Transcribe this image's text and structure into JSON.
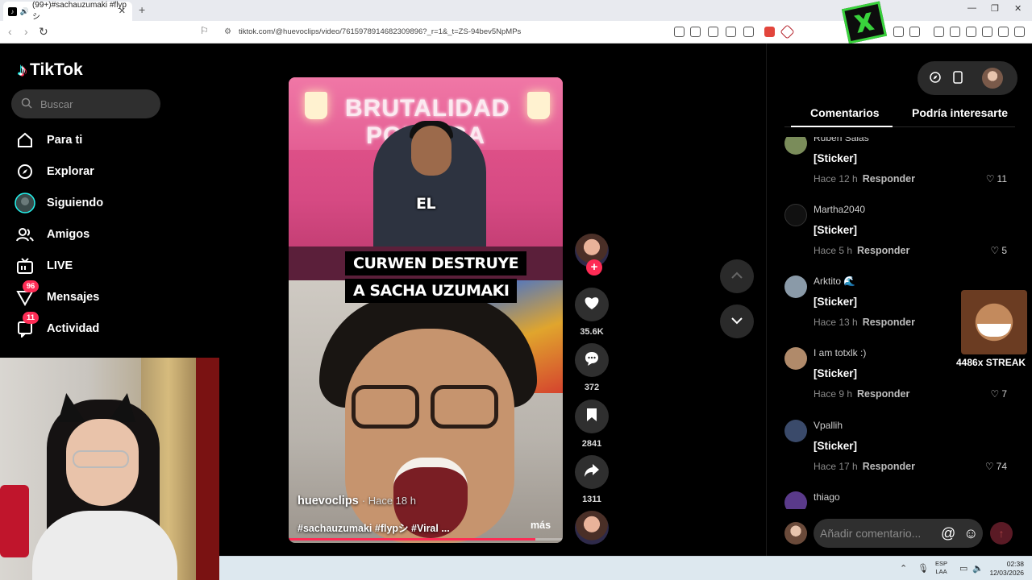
{
  "browser": {
    "tab_title": "(99+)#sachauzumaki #flypシ",
    "url": "tiktok.com/@huevoclips/video/7615978914682309896?_r=1&_t=ZS-94bev5NpMPs"
  },
  "sidebar": {
    "logo": "TikTok",
    "search_placeholder": "Buscar",
    "items": [
      {
        "label": "Para ti",
        "icon": "home-icon"
      },
      {
        "label": "Explorar",
        "icon": "compass-icon"
      },
      {
        "label": "Siguiendo",
        "icon": "following-avatar-icon"
      },
      {
        "label": "Amigos",
        "icon": "friends-icon"
      },
      {
        "label": "LIVE",
        "icon": "live-icon"
      },
      {
        "label": "Mensajes",
        "icon": "inbox-icon",
        "badge": "96"
      },
      {
        "label": "Actividad",
        "icon": "activity-icon",
        "badge": "11"
      }
    ]
  },
  "video": {
    "caption_el": "EL",
    "caption_line1": "CURWEN DESTRUYE",
    "caption_line2": "A SACHA UZUMAKI",
    "sign_text": "BRUTALIDAD POLITICA",
    "author": "huevoclips",
    "time": "· Hace 18 h",
    "tags": "#sachauzumaki #flypシ #Viral ...",
    "more": "más",
    "progress": 0.9
  },
  "actions": {
    "likes": "35.6K",
    "comments": "372",
    "saves": "2841",
    "shares": "1311"
  },
  "panel": {
    "tab_comments": "Comentarios",
    "tab_interest": "Podría interesarte",
    "comments": [
      {
        "name": "Ruben Salas",
        "text": "[Sticker]",
        "time": "Hace 12 h",
        "reply": "Responder",
        "likes": "11",
        "avatar_color": "#7a8c5a"
      },
      {
        "name": "Martha2040",
        "text": "[Sticker]",
        "time": "Hace 5 h",
        "reply": "Responder",
        "likes": "5",
        "avatar_color": "#111111"
      },
      {
        "name": "Arktito 🌊",
        "text": "[Sticker]",
        "time": "Hace 13 h",
        "reply": "Responder",
        "likes": "",
        "avatar_color": "#8a9aa8"
      },
      {
        "name": "I am totxlk :)",
        "text": "[Sticker]",
        "time": "Hace 9 h",
        "reply": "Responder",
        "likes": "7",
        "avatar_color": "#b08a6a"
      },
      {
        "name": "Vpallih",
        "text": "[Sticker]",
        "time": "Hace 17 h",
        "reply": "Responder",
        "likes": "74",
        "avatar_color": "#3a4a6a"
      },
      {
        "name": "thiago",
        "text": "",
        "time": "",
        "reply": "",
        "likes": "",
        "avatar_color": "#5a3a8a"
      }
    ],
    "comment_placeholder": "Añadir comentario...",
    "at_symbol": "@",
    "streak_text": "4486x STREAK"
  },
  "taskbar": {
    "lang_line1": "ESP",
    "lang_line2": "LAA",
    "time": "02:38",
    "date": "12/03/2026"
  },
  "colors": {
    "accent": "#fe2c55",
    "panel_bg": "#000000",
    "input_bg": "#2f2f2f"
  }
}
